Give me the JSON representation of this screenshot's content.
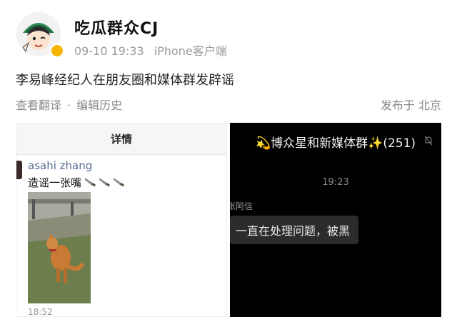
{
  "post": {
    "username": "吃瓜群众CJ",
    "timestamp": "09-10 19:33",
    "client": "iPhone客户端",
    "text": "李易峰经纪人在朋友圈和媒体群发辟谣",
    "translate": "查看翻译",
    "separator": "·",
    "history": "编辑历史",
    "location": "发布于 北京"
  },
  "left_image": {
    "header": "详情",
    "moment_user": "asahi zhang",
    "moment_text": "造谣一张嘴",
    "moment_time": "18:52"
  },
  "right_image": {
    "group_name": "博众星和新媒体群",
    "spark_left": "💫",
    "spark_right": "✨",
    "member_count": "(251)",
    "chat_time": "19:23",
    "sender": "张阿信",
    "message": "一直在处理问题，被黑"
  },
  "colors": {
    "link": "#576b95",
    "verified": "#f5b400",
    "dark_bg": "#000000"
  }
}
